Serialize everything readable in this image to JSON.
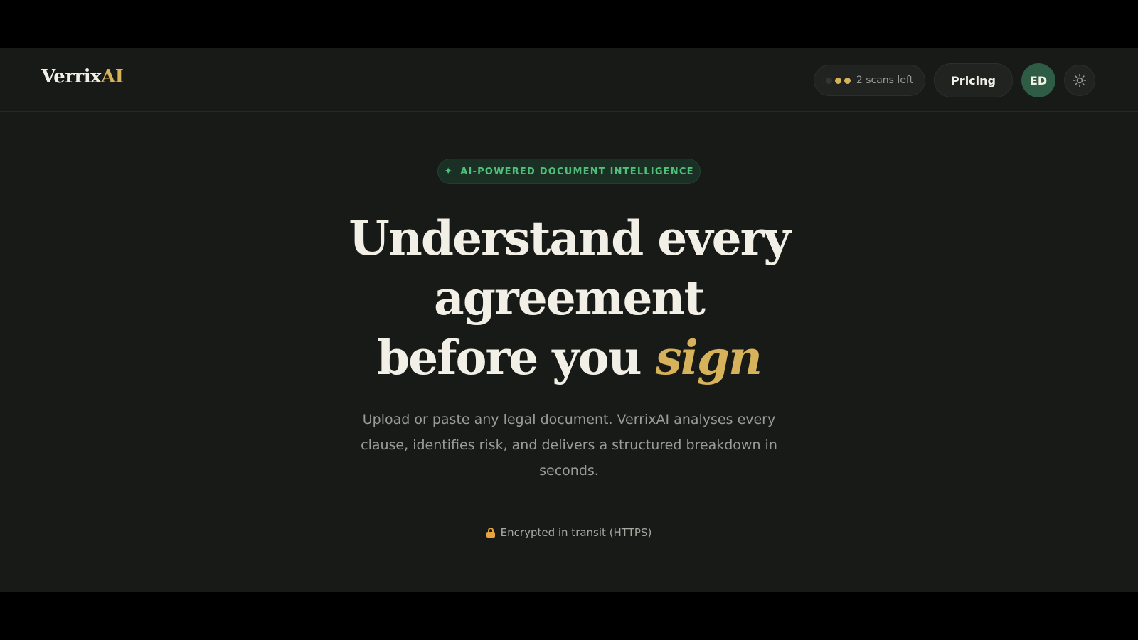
{
  "brand": {
    "logo_primary": "Verrix",
    "logo_accent": "AI",
    "accent_color": "#d6b25a",
    "green_color": "#4fbf79"
  },
  "header": {
    "scans": {
      "label": "2 scans left",
      "total": 3,
      "remaining": 2
    },
    "pricing_label": "Pricing",
    "avatar_initials": "ED",
    "theme_toggle_icon": "sun-icon"
  },
  "hero": {
    "badge_icon": "sparkle-icon",
    "badge_text": "AI-POWERED DOCUMENT INTELLIGENCE",
    "title_line1": "Understand every",
    "title_line2": "agreement",
    "title_line3_start": "before you",
    "title_line3_accent": "sign",
    "subtitle": "Upload or paste any legal document. VerrixAI analyses every clause, identifies risk, and delivers a structured breakdown in seconds.",
    "security_icon": "lock-icon",
    "security_text": "Encrypted in transit (HTTPS)"
  }
}
